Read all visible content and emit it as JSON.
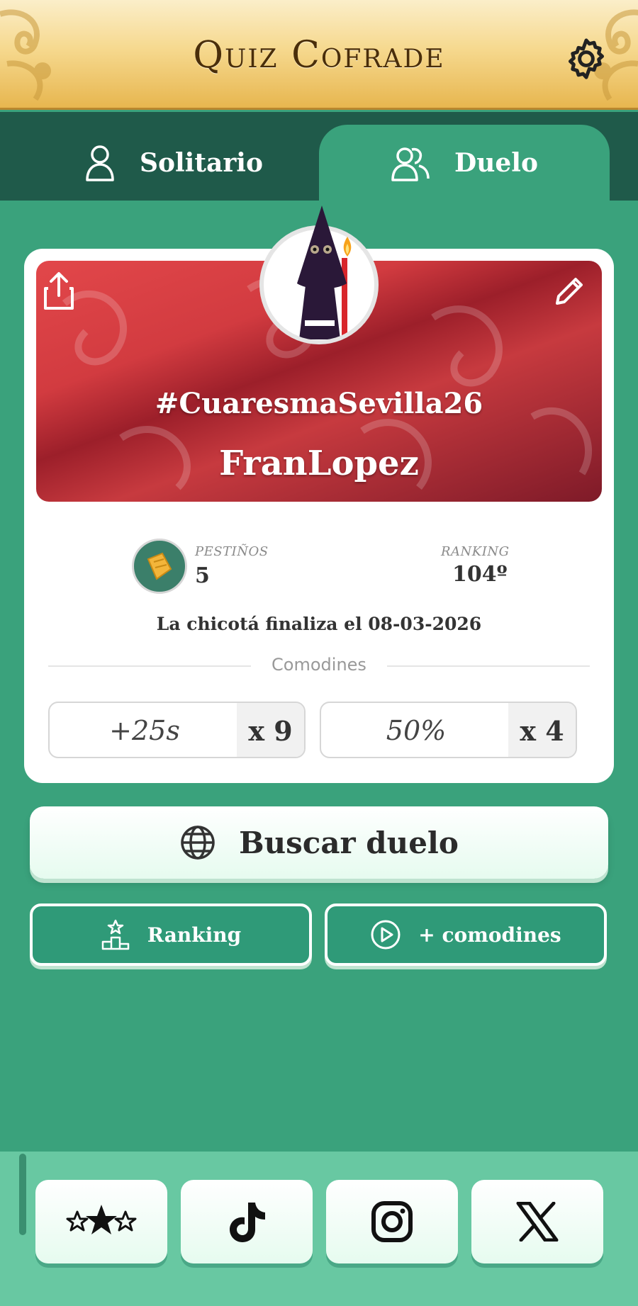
{
  "header": {
    "title": "Quiz Cofrade"
  },
  "tabs": [
    {
      "label": "Solitario",
      "icon": "user-icon",
      "active": false
    },
    {
      "label": "Duelo",
      "icon": "users-icon",
      "active": true
    }
  ],
  "profile": {
    "hashtag": "#CuaresmaSevilla26",
    "username": "FranLopez",
    "avatar": "nazareno-avatar"
  },
  "stats": {
    "pestinos_label": "PESTIÑOS",
    "pestinos_value": "5",
    "ranking_label": "RANKING",
    "ranking_value": "104º"
  },
  "deadline": "La chicotá finaliza el 08-03-2026",
  "jokers_title": "Comodines",
  "jokers": [
    {
      "value": "+25s",
      "count": "x 9"
    },
    {
      "value": "50%",
      "count": "x 4"
    }
  ],
  "actions": {
    "search_duel": "Buscar duelo",
    "ranking": "Ranking",
    "more_jokers": "+ comodines"
  },
  "social": [
    "rate-stars-icon",
    "tiktok-icon",
    "instagram-icon",
    "x-icon"
  ],
  "colors": {
    "background": "#3aa27c",
    "tab_bar": "#1f5a4a",
    "banner_red": "#d23b40",
    "header_gold": "#f6d98f"
  }
}
